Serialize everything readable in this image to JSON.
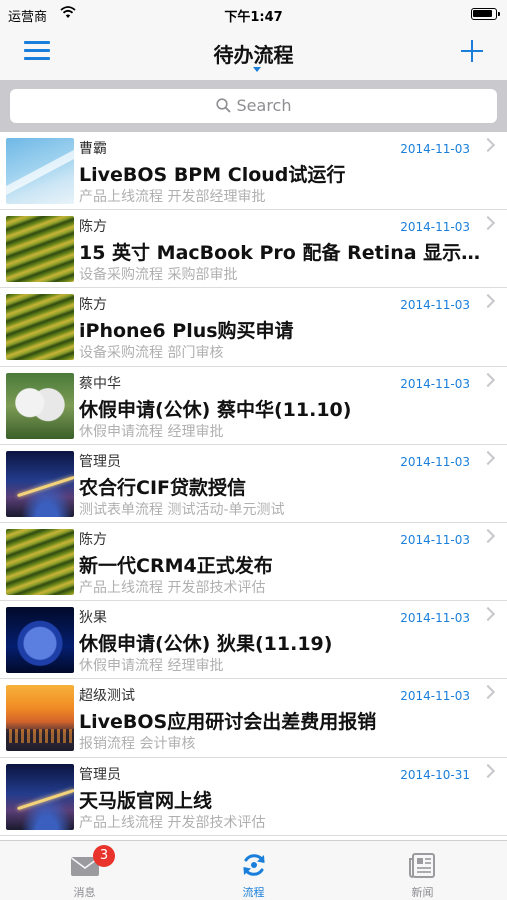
{
  "status_bar": {
    "carrier": "运营商",
    "time": "下午1:47"
  },
  "nav": {
    "title": "待办流程",
    "menu_icon": "hamburger-menu-icon",
    "add_icon": "plus-icon"
  },
  "search": {
    "placeholder": "Search"
  },
  "colors": {
    "accent": "#1a7fdb",
    "badge": "#e8342c",
    "subtitle": "#b0b0b0"
  },
  "items": [
    {
      "sender": "曹霸",
      "date": "2014-11-03",
      "title": "LiveBOS BPM Cloud试运行",
      "subtitle": "产品上线流程 开发部经理审批",
      "thumb": "sky"
    },
    {
      "sender": "陈方",
      "date": "2014-11-03",
      "title": "15 英寸 MacBook Pro 配备 Retina 显示…",
      "subtitle": "设备采购流程 采购部审批",
      "thumb": "terrace"
    },
    {
      "sender": "陈方",
      "date": "2014-11-03",
      "title": "iPhone6 Plus购买申请",
      "subtitle": "设备采购流程 部门审核",
      "thumb": "terrace"
    },
    {
      "sender": "蔡中华",
      "date": "2014-11-03",
      "title": "休假申请(公休) 蔡中华(11.10)",
      "subtitle": "休假申请流程 经理审批",
      "thumb": "panda"
    },
    {
      "sender": "管理员",
      "date": "2014-11-03",
      "title": "农合行CIF贷款授信",
      "subtitle": "测试表单流程 测试活动-单元测试",
      "thumb": "road"
    },
    {
      "sender": "陈方",
      "date": "2014-11-03",
      "title": "新一代CRM4正式发布",
      "subtitle": "产品上线流程 开发部技术评估",
      "thumb": "terrace"
    },
    {
      "sender": "狄果",
      "date": "2014-11-03",
      "title": "休假申请(公休) 狄果(11.19)",
      "subtitle": "休假申请流程 经理审批",
      "thumb": "apple"
    },
    {
      "sender": "超级测试",
      "date": "2014-11-03",
      "title": "LiveBOS应用研讨会出差费用报销",
      "subtitle": "报销流程 会计审核",
      "thumb": "sunset"
    },
    {
      "sender": "管理员",
      "date": "2014-10-31",
      "title": "天马版官网上线",
      "subtitle": "产品上线流程 开发部技术评估",
      "thumb": "road"
    }
  ],
  "tabs": [
    {
      "label": "消息",
      "icon": "mail-icon",
      "badge": "3"
    },
    {
      "label": "流程",
      "icon": "refresh-flow-icon",
      "active": true
    },
    {
      "label": "新闻",
      "icon": "newspaper-icon"
    }
  ]
}
